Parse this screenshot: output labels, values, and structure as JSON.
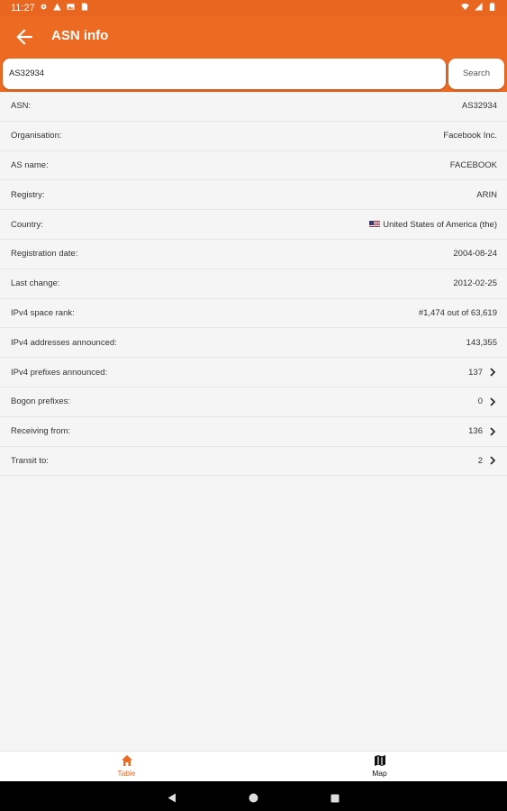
{
  "status": {
    "time": "11:27",
    "left_icons": [
      "settings-icon",
      "warning-icon",
      "image-icon",
      "sim-icon"
    ],
    "right_icons": [
      "wifi-icon",
      "signal-icon",
      "battery-icon"
    ]
  },
  "appbar": {
    "title": "ASN info"
  },
  "search": {
    "value": "AS32934",
    "button": "Search"
  },
  "rows": [
    {
      "label": "ASN:",
      "value": "AS32934"
    },
    {
      "label": "Organisation:",
      "value": "Facebook Inc."
    },
    {
      "label": "AS name:",
      "value": "FACEBOOK"
    },
    {
      "label": "Registry:",
      "value": "ARIN"
    },
    {
      "label": "Country:",
      "value": "United States of America (the)"
    },
    {
      "label": "Registration date:",
      "value": "2004-08-24"
    },
    {
      "label": "Last change:",
      "value": "2012-02-25"
    },
    {
      "label": "IPv4 space rank:",
      "value": "#1,474 out of 63,619"
    },
    {
      "label": "IPv4 addresses announced:",
      "value": "143,355"
    },
    {
      "label": "IPv4 prefixes announced:",
      "value": "137"
    },
    {
      "label": "Bogon prefixes:",
      "value": "0"
    },
    {
      "label": "Receiving from:",
      "value": "136"
    },
    {
      "label": "Transit to:",
      "value": "2"
    }
  ],
  "bottom_nav": [
    {
      "label": "Table",
      "icon": "home-icon"
    },
    {
      "label": "Map",
      "icon": "map-icon"
    }
  ],
  "colors": {
    "accent": "#ec6a22"
  }
}
